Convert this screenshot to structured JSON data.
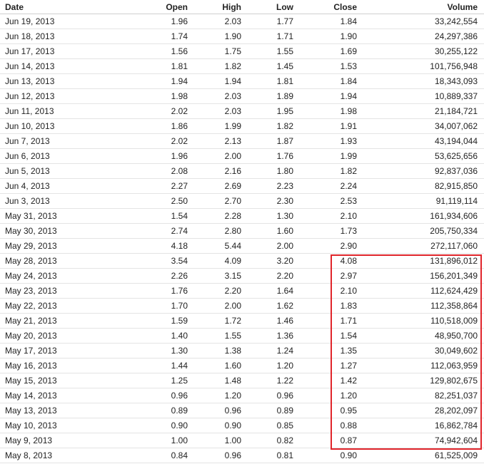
{
  "headers": {
    "date": "Date",
    "open": "Open",
    "high": "High",
    "low": "Low",
    "close": "Close",
    "volume": "Volume"
  },
  "highlight_color": "#e0252b",
  "rows": [
    {
      "date": "Jun 19, 2013",
      "open": "1.96",
      "high": "2.03",
      "low": "1.77",
      "close": "1.84",
      "volume": "33,242,554"
    },
    {
      "date": "Jun 18, 2013",
      "open": "1.74",
      "high": "1.90",
      "low": "1.71",
      "close": "1.90",
      "volume": "24,297,386"
    },
    {
      "date": "Jun 17, 2013",
      "open": "1.56",
      "high": "1.75",
      "low": "1.55",
      "close": "1.69",
      "volume": "30,255,122"
    },
    {
      "date": "Jun 14, 2013",
      "open": "1.81",
      "high": "1.82",
      "low": "1.45",
      "close": "1.53",
      "volume": "101,756,948"
    },
    {
      "date": "Jun 13, 2013",
      "open": "1.94",
      "high": "1.94",
      "low": "1.81",
      "close": "1.84",
      "volume": "18,343,093"
    },
    {
      "date": "Jun 12, 2013",
      "open": "1.98",
      "high": "2.03",
      "low": "1.89",
      "close": "1.94",
      "volume": "10,889,337"
    },
    {
      "date": "Jun 11, 2013",
      "open": "2.02",
      "high": "2.03",
      "low": "1.95",
      "close": "1.98",
      "volume": "21,184,721"
    },
    {
      "date": "Jun 10, 2013",
      "open": "1.86",
      "high": "1.99",
      "low": "1.82",
      "close": "1.91",
      "volume": "34,007,062"
    },
    {
      "date": "Jun 7, 2013",
      "open": "2.02",
      "high": "2.13",
      "low": "1.87",
      "close": "1.93",
      "volume": "43,194,044"
    },
    {
      "date": "Jun 6, 2013",
      "open": "1.96",
      "high": "2.00",
      "low": "1.76",
      "close": "1.99",
      "volume": "53,625,656"
    },
    {
      "date": "Jun 5, 2013",
      "open": "2.08",
      "high": "2.16",
      "low": "1.80",
      "close": "1.82",
      "volume": "92,837,036"
    },
    {
      "date": "Jun 4, 2013",
      "open": "2.27",
      "high": "2.69",
      "low": "2.23",
      "close": "2.24",
      "volume": "82,915,850"
    },
    {
      "date": "Jun 3, 2013",
      "open": "2.50",
      "high": "2.70",
      "low": "2.30",
      "close": "2.53",
      "volume": "91,119,114"
    },
    {
      "date": "May 31, 2013",
      "open": "1.54",
      "high": "2.28",
      "low": "1.30",
      "close": "2.10",
      "volume": "161,934,606"
    },
    {
      "date": "May 30, 2013",
      "open": "2.74",
      "high": "2.80",
      "low": "1.60",
      "close": "1.73",
      "volume": "205,750,334"
    },
    {
      "date": "May 29, 2013",
      "open": "4.18",
      "high": "5.44",
      "low": "2.00",
      "close": "2.90",
      "volume": "272,117,060"
    },
    {
      "date": "May 28, 2013",
      "open": "3.54",
      "high": "4.09",
      "low": "3.20",
      "close": "4.08",
      "volume": "131,896,012"
    },
    {
      "date": "May 24, 2013",
      "open": "2.26",
      "high": "3.15",
      "low": "2.20",
      "close": "2.97",
      "volume": "156,201,349"
    },
    {
      "date": "May 23, 2013",
      "open": "1.76",
      "high": "2.20",
      "low": "1.64",
      "close": "2.10",
      "volume": "112,624,429"
    },
    {
      "date": "May 22, 2013",
      "open": "1.70",
      "high": "2.00",
      "low": "1.62",
      "close": "1.83",
      "volume": "112,358,864"
    },
    {
      "date": "May 21, 2013",
      "open": "1.59",
      "high": "1.72",
      "low": "1.46",
      "close": "1.71",
      "volume": "110,518,009"
    },
    {
      "date": "May 20, 2013",
      "open": "1.40",
      "high": "1.55",
      "low": "1.36",
      "close": "1.54",
      "volume": "48,950,700"
    },
    {
      "date": "May 17, 2013",
      "open": "1.30",
      "high": "1.38",
      "low": "1.24",
      "close": "1.35",
      "volume": "30,049,602"
    },
    {
      "date": "May 16, 2013",
      "open": "1.44",
      "high": "1.60",
      "low": "1.20",
      "close": "1.27",
      "volume": "112,063,959"
    },
    {
      "date": "May 15, 2013",
      "open": "1.25",
      "high": "1.48",
      "low": "1.22",
      "close": "1.42",
      "volume": "129,802,675"
    },
    {
      "date": "May 14, 2013",
      "open": "0.96",
      "high": "1.20",
      "low": "0.96",
      "close": "1.20",
      "volume": "82,251,037"
    },
    {
      "date": "May 13, 2013",
      "open": "0.89",
      "high": "0.96",
      "low": "0.89",
      "close": "0.95",
      "volume": "28,202,097"
    },
    {
      "date": "May 10, 2013",
      "open": "0.90",
      "high": "0.90",
      "low": "0.85",
      "close": "0.88",
      "volume": "16,862,784"
    },
    {
      "date": "May 9, 2013",
      "open": "1.00",
      "high": "1.00",
      "low": "0.82",
      "close": "0.87",
      "volume": "74,942,604"
    },
    {
      "date": "May 8, 2013",
      "open": "0.84",
      "high": "0.96",
      "low": "0.81",
      "close": "0.90",
      "volume": "61,525,009"
    }
  ]
}
